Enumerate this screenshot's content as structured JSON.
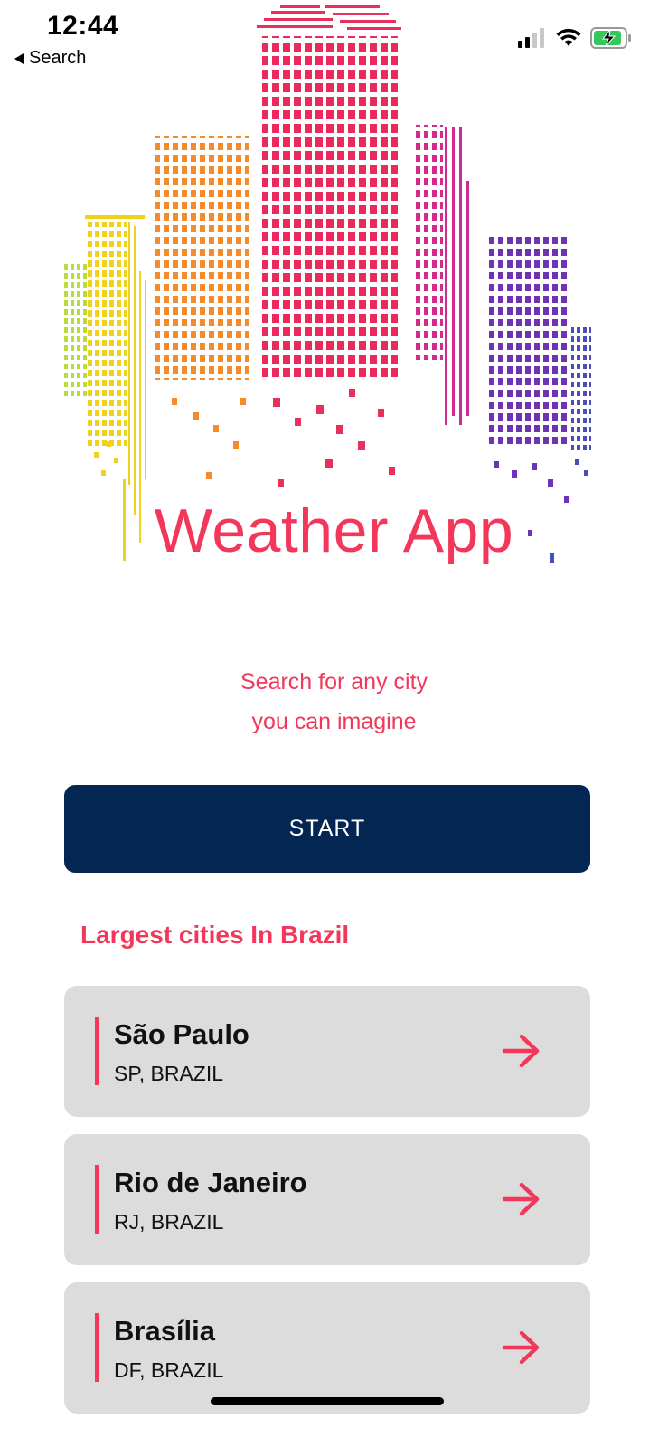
{
  "status_bar": {
    "time": "12:44",
    "back_label": "Search"
  },
  "hero": {
    "title": "Weather App",
    "illustration_icon": "city-skyline-icon"
  },
  "tagline": {
    "line1": "Search for any city",
    "line2": "you can imagine"
  },
  "start_button": {
    "label": "START"
  },
  "section": {
    "title": "Largest cities In Brazil"
  },
  "cities": [
    {
      "name": "São Paulo",
      "region": "SP, BRAZIL"
    },
    {
      "name": "Rio de Janeiro",
      "region": "RJ, BRAZIL"
    },
    {
      "name": "Brasília",
      "region": "DF, BRAZIL"
    }
  ],
  "colors": {
    "accent": "#f2375a",
    "button": "#032652",
    "card": "#dcdcdc"
  }
}
